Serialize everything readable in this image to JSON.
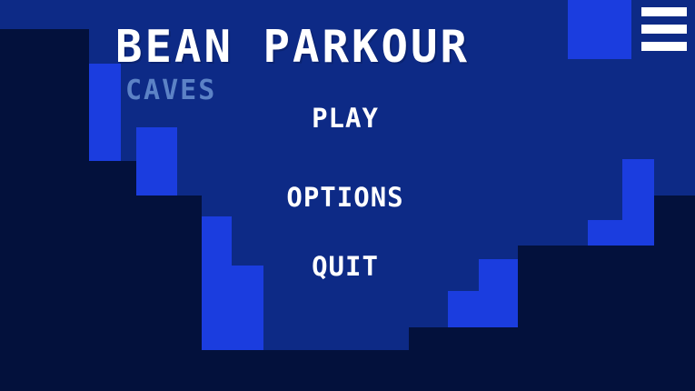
{
  "game": {
    "title": "BEAN PARKOUR",
    "subtitle": "CAVES"
  },
  "menu": {
    "play_label": "PLAY",
    "options_label": "OPTIONS",
    "quit_label": "QUIT"
  },
  "top_right_control": {
    "icon": "hamburger-menu-icon"
  },
  "colors": {
    "cave_dark": "#03113c",
    "cave_mid": "#0d2a86",
    "cave_bright": "#1b3ddf",
    "title_text": "#ffffff",
    "subtitle_text": "#5c82c6",
    "button_text": "#ffffff"
  }
}
